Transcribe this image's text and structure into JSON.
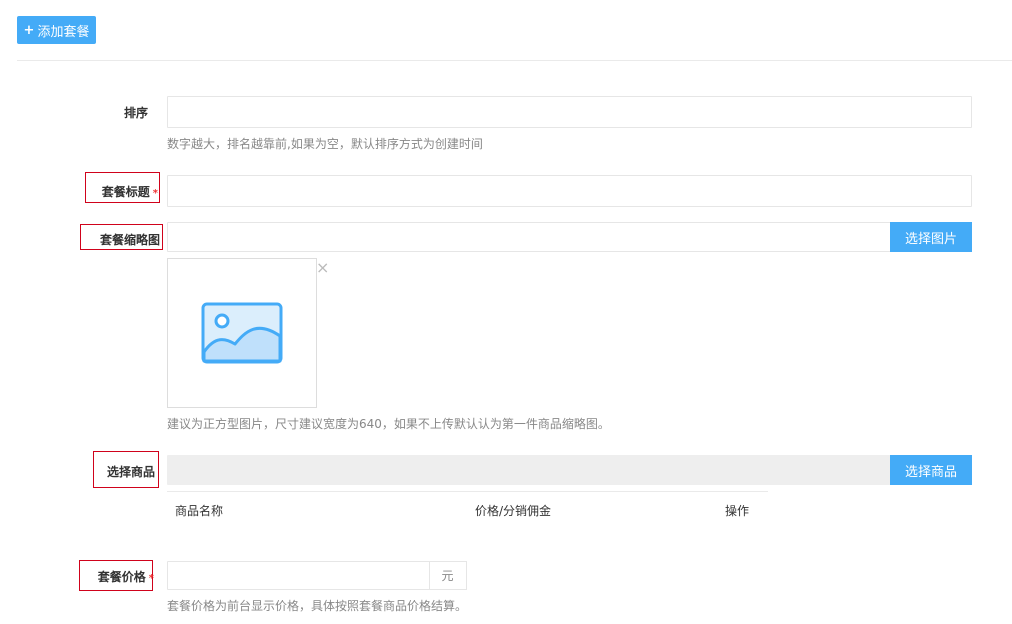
{
  "toolbar": {
    "add_label": "添加套餐",
    "add_icon": "+"
  },
  "form": {
    "sort": {
      "label": "排序",
      "value": "",
      "hint": "数字越大，排名越靠前,如果为空，默认排序方式为创建时间"
    },
    "title": {
      "label": "套餐标题",
      "required": "*",
      "value": ""
    },
    "thumbnail": {
      "label": "套餐缩略图",
      "value": "",
      "button": "选择图片",
      "remove": "×",
      "hint": "建议为正方型图片，尺寸建议宽度为640，如果不上传默认认为第一件商品缩略图。"
    },
    "goods": {
      "label": "选择商品",
      "button": "选择商品",
      "columns": [
        "商品名称",
        "价格/分销佣金",
        "操作"
      ]
    },
    "price": {
      "label": "套餐价格",
      "required": "*",
      "value": "",
      "unit": "元",
      "hint": "套餐价格为前台显示价格，具体按照套餐商品价格结算。"
    }
  },
  "colors": {
    "accent": "#44abf7",
    "highlight_border": "#d0021b",
    "required": "#ee3333"
  }
}
